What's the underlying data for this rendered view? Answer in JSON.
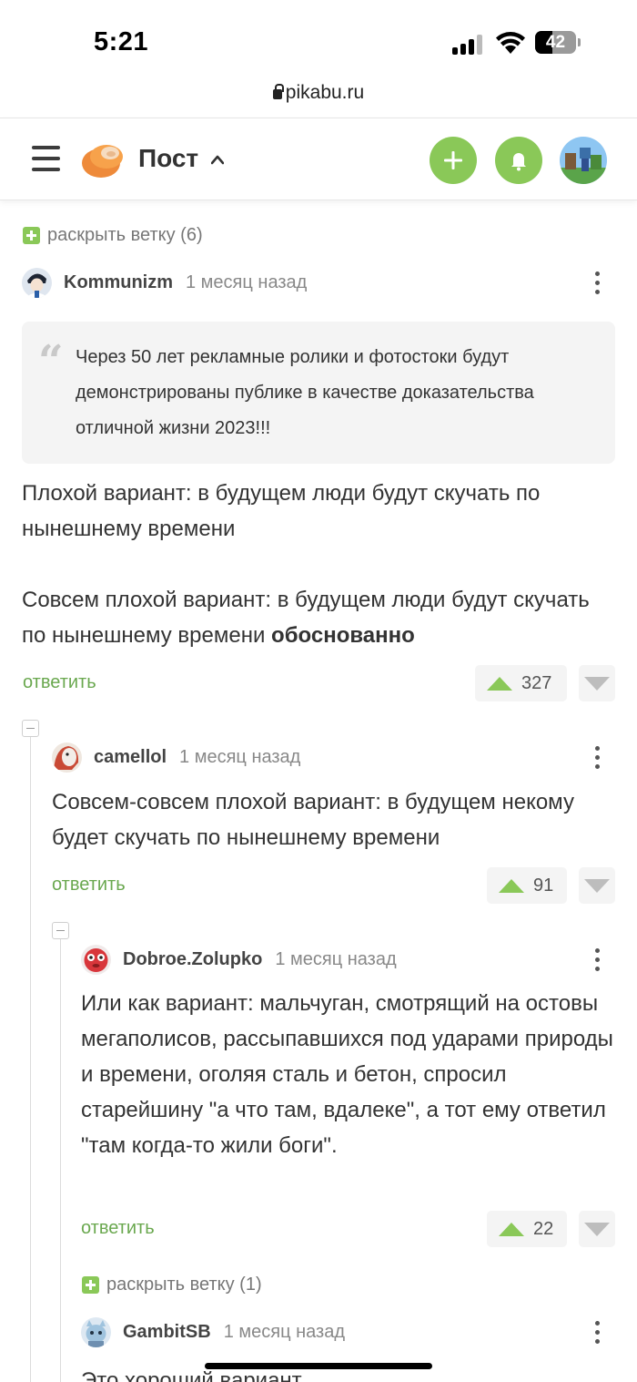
{
  "status": {
    "time": "5:21",
    "battery": "42"
  },
  "browser": {
    "url": "pikabu.ru"
  },
  "header": {
    "title": "Пост"
  },
  "expand_top": {
    "label": "раскрыть ветку (6)"
  },
  "comments": [
    {
      "user": "Kommunizm",
      "time": "1 месяц назад",
      "quote": "Через 50 лет рекламные ролики и фотостоки будут демонстрированы публике в качестве доказательства отличной жизни 2023!!!",
      "p1": "Плохой вариант: в будущем люди будут скучать по нынешнему времени",
      "p2": "Совсем плохой вариант: в будущем люди будут скучать по нынешнему времени ",
      "p2_bold": "обоснованно",
      "reply": "ответить",
      "rating": "327"
    },
    {
      "user": "camellol",
      "time": "1 месяц назад",
      "text": "Совсем-совсем плохой вариант: в будущем некому будет скучать по нынешнему времени",
      "reply": "ответить",
      "rating": "91"
    },
    {
      "user": "Dobroe.Zolupko",
      "time": "1 месяц назад",
      "text": "Или как вариант: мальчуган, смотрящий на остовы мегаполисов, рассыпавшихся под ударами природы и времени, оголяя сталь и бетон, спросил старейшину \"а что там, вдалеке\", а тот ему ответил \"там когда-то жили боги\".",
      "reply": "ответить",
      "rating": "22"
    },
    {
      "user": "GambitSB",
      "time": "1 месяц назад",
      "text": "Это хороший вариант"
    }
  ],
  "expand_nested": {
    "label": "раскрыть ветку (1)"
  },
  "colors": {
    "accent": "#8ac858",
    "link": "#6aa84f",
    "quote_bg": "#f4f4f4"
  }
}
